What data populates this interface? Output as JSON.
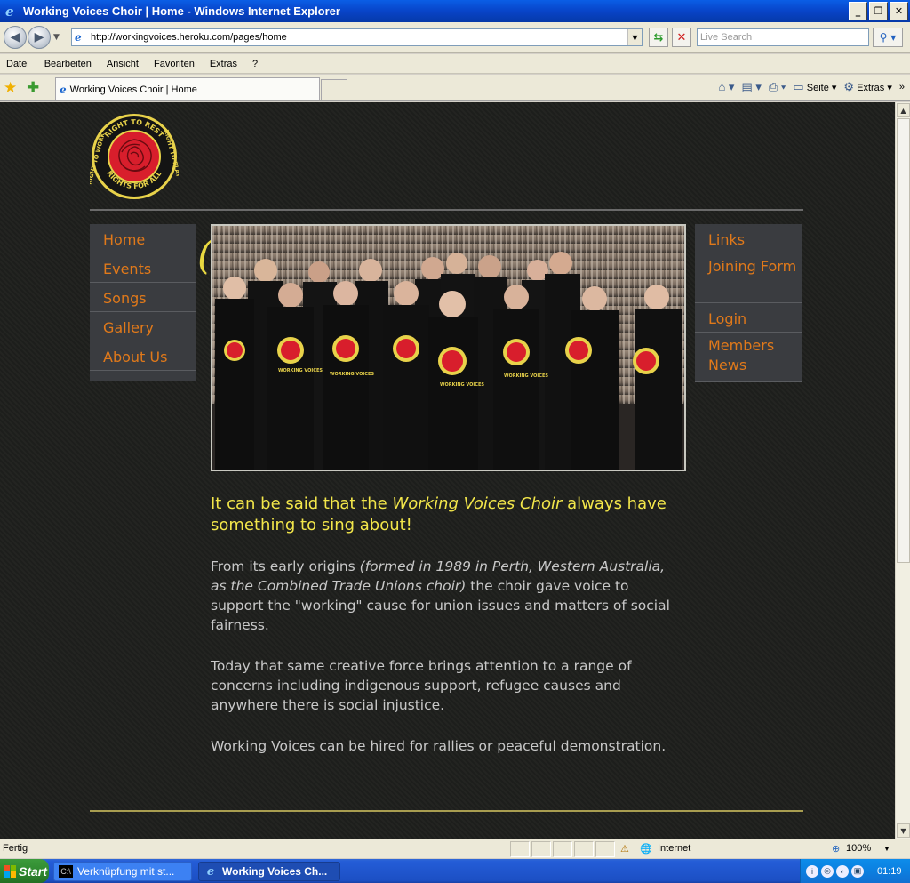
{
  "window": {
    "title": "Working Voices Choir | Home - Windows Internet Explorer",
    "buttons": {
      "minimize": "_",
      "maximize": "❐",
      "close": "✕"
    }
  },
  "address_bar": {
    "url": "http://workingvoices.heroku.com/pages/home",
    "search_placeholder": "Live Search"
  },
  "menu": [
    "Datei",
    "Bearbeiten",
    "Ansicht",
    "Favoriten",
    "Extras",
    "?"
  ],
  "tabs": [
    {
      "label": "Working Voices Choir | Home"
    }
  ],
  "command_bar": {
    "page_label": "Seite",
    "tools_label": "Extras",
    "more": "»"
  },
  "site": {
    "logo_text": [
      "RIGHT TO WORK",
      "RIGHT TO REST",
      "RIGHT TO PLAY",
      "RIGHTS FOR ALL"
    ],
    "nav_left": [
      "Home",
      "Events",
      "Songs",
      "Gallery",
      "About Us"
    ],
    "nav_right": [
      "Links",
      "Joining Form",
      "Login",
      "Members News"
    ],
    "shirt_text": "WORKING VOICES",
    "intro_before": "It can be said that the ",
    "intro_em": "Working Voices Choir",
    "intro_after": " always have something to sing about!",
    "para1_before": "From its early origins ",
    "para1_em": "(formed in 1989 in Perth, Western Australia, as the Combined Trade Unions choir)",
    "para1_after": " the choir gave voice to support the \"working\" cause for union issues and matters of social fairness.",
    "para2": "Today that same creative force brings attention to a range of concerns including indigenous support, refugee causes and anywhere there is social injustice.",
    "para3": "Working Voices can be hired for rallies or peaceful demonstration."
  },
  "status_bar": {
    "status": "Fertig",
    "zone": "Internet",
    "zoom": "100%"
  },
  "taskbar": {
    "start": "Start",
    "items": [
      "Verknüpfung mit st...",
      "Working Voices Ch..."
    ],
    "clock": "01:19"
  },
  "colors": {
    "nav_text": "#e0791a",
    "intro_text": "#f2e64a",
    "body_text": "#c8c8c8",
    "page_bg": "#1f1f1f"
  }
}
